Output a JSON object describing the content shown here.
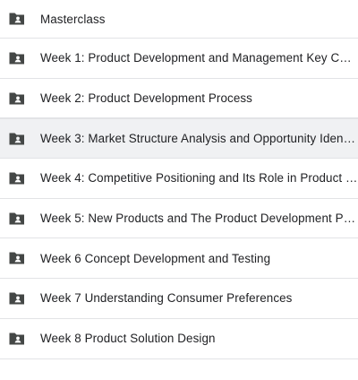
{
  "folders": [
    {
      "label": "Masterclass",
      "icon": "shared-folder-icon"
    },
    {
      "label": "Week 1: Product Development and Management Key Con...",
      "icon": "shared-folder-icon"
    },
    {
      "label": "Week 2: Product Development Process",
      "icon": "shared-folder-icon"
    },
    {
      "label": "Week 3: Market Structure Analysis and Opportunity Identi...",
      "icon": "shared-folder-icon",
      "selected": true
    },
    {
      "label": "Week 4: Competitive Positioning and Its Role in Product D...",
      "icon": "shared-folder-icon"
    },
    {
      "label": "Week 5: New Products and The Product Development Pro...",
      "icon": "shared-folder-icon"
    },
    {
      "label": "Week 6 Concept Development and Testing",
      "icon": "shared-folder-icon"
    },
    {
      "label": "Week 7 Understanding Consumer Preferences",
      "icon": "shared-folder-icon"
    },
    {
      "label": "Week 8 Product Solution Design",
      "icon": "shared-folder-icon"
    }
  ],
  "colors": {
    "icon": "#444746",
    "text": "#202124",
    "divider": "#e2e3e6",
    "selected_bg": "#f0f1f3"
  }
}
